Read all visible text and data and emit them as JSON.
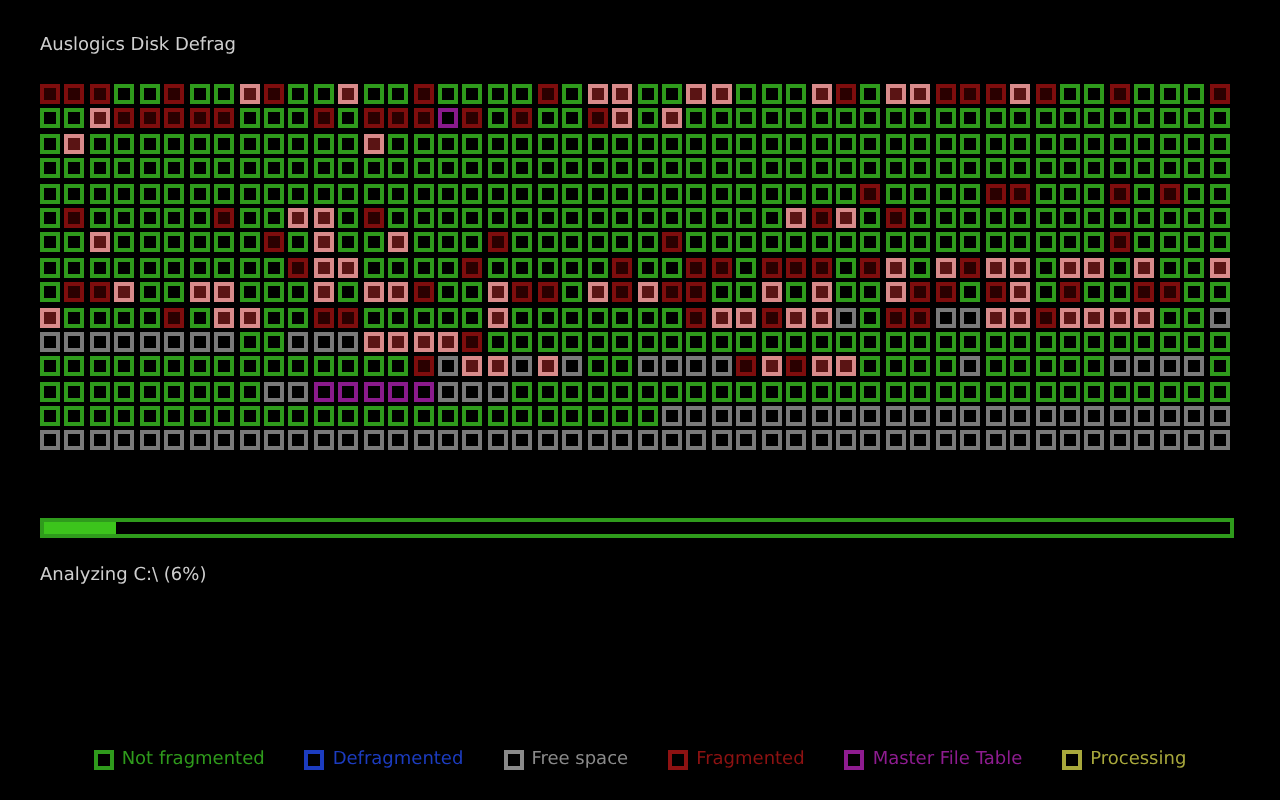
{
  "window": {
    "title": "Auslogics Disk Defrag"
  },
  "disk_map": {
    "rows": [
      [
        {
          "kind": "frag"
        },
        {
          "kind": "frag"
        },
        {
          "kind": "frag"
        },
        {
          "kind": "ok"
        },
        {
          "kind": "ok"
        },
        {
          "kind": "frag"
        },
        {
          "kind": "ok"
        },
        {
          "kind": "ok"
        },
        {
          "kind": "heavy"
        },
        {
          "kind": "frag"
        },
        {
          "kind": "ok"
        },
        {
          "kind": "ok"
        },
        {
          "kind": "heavy"
        },
        {
          "kind": "ok"
        },
        {
          "kind": "ok"
        },
        {
          "kind": "frag"
        },
        {
          "kind": "ok"
        },
        {
          "kind": "ok"
        },
        {
          "kind": "ok"
        },
        {
          "kind": "ok"
        },
        {
          "kind": "frag"
        },
        {
          "kind": "ok"
        },
        {
          "kind": "heavy"
        },
        {
          "kind": "heavy"
        },
        {
          "kind": "ok"
        },
        {
          "kind": "ok"
        },
        {
          "kind": "heavy"
        },
        {
          "kind": "heavy"
        },
        {
          "kind": "ok"
        },
        {
          "kind": "ok"
        },
        {
          "kind": "ok"
        },
        {
          "kind": "heavy"
        },
        {
          "kind": "frag"
        },
        {
          "kind": "ok"
        },
        {
          "kind": "heavy"
        },
        {
          "kind": "heavy"
        },
        {
          "kind": "frag"
        },
        {
          "kind": "frag"
        },
        {
          "kind": "frag"
        },
        {
          "kind": "heavy"
        },
        {
          "kind": "frag"
        },
        {
          "kind": "ok"
        },
        {
          "kind": "ok"
        },
        {
          "kind": "frag"
        },
        {
          "kind": "ok"
        },
        {
          "kind": "ok"
        },
        {
          "kind": "ok"
        },
        {
          "kind": "frag"
        }
      ],
      [
        {
          "kind": "ok"
        },
        {
          "kind": "ok"
        },
        {
          "kind": "heavy"
        },
        {
          "kind": "frag"
        },
        {
          "kind": "frag"
        },
        {
          "kind": "frag"
        },
        {
          "kind": "frag"
        },
        {
          "kind": "frag"
        },
        {
          "kind": "ok"
        },
        {
          "kind": "ok"
        },
        {
          "kind": "ok"
        },
        {
          "kind": "frag"
        },
        {
          "kind": "ok"
        },
        {
          "kind": "frag"
        },
        {
          "kind": "frag"
        },
        {
          "kind": "frag"
        },
        {
          "kind": "mft"
        },
        {
          "kind": "frag"
        },
        {
          "kind": "ok"
        },
        {
          "kind": "frag"
        },
        {
          "kind": "ok"
        },
        {
          "kind": "ok"
        },
        {
          "kind": "frag"
        },
        {
          "kind": "heavy"
        },
        {
          "kind": "ok"
        },
        {
          "kind": "heavy"
        },
        {
          "kind": "ok"
        },
        {
          "kind": "ok"
        },
        {
          "kind": "ok"
        },
        {
          "kind": "ok"
        },
        {
          "kind": "ok"
        },
        {
          "kind": "ok"
        },
        {
          "kind": "ok"
        },
        {
          "kind": "ok"
        },
        {
          "kind": "ok"
        },
        {
          "kind": "ok"
        },
        {
          "kind": "ok"
        },
        {
          "kind": "ok"
        },
        {
          "kind": "ok"
        },
        {
          "kind": "ok"
        },
        {
          "kind": "ok"
        },
        {
          "kind": "ok"
        },
        {
          "kind": "ok"
        },
        {
          "kind": "ok"
        },
        {
          "kind": "ok"
        },
        {
          "kind": "ok"
        },
        {
          "kind": "ok"
        },
        {
          "kind": "ok"
        }
      ],
      [
        {
          "kind": "ok"
        },
        {
          "kind": "heavy"
        },
        {
          "kind": "ok"
        },
        {
          "kind": "ok"
        },
        {
          "kind": "ok"
        },
        {
          "kind": "ok"
        },
        {
          "kind": "ok"
        },
        {
          "kind": "ok"
        },
        {
          "kind": "ok"
        },
        {
          "kind": "ok"
        },
        {
          "kind": "ok"
        },
        {
          "kind": "ok"
        },
        {
          "kind": "ok"
        },
        {
          "kind": "heavy"
        },
        {
          "kind": "ok"
        },
        {
          "kind": "ok"
        },
        {
          "kind": "ok"
        },
        {
          "kind": "ok"
        },
        {
          "kind": "ok"
        },
        {
          "kind": "ok"
        },
        {
          "kind": "ok"
        },
        {
          "kind": "ok"
        },
        {
          "kind": "ok"
        },
        {
          "kind": "ok"
        },
        {
          "kind": "ok"
        },
        {
          "kind": "ok"
        },
        {
          "kind": "ok"
        },
        {
          "kind": "ok"
        },
        {
          "kind": "ok"
        },
        {
          "kind": "ok"
        },
        {
          "kind": "ok"
        },
        {
          "kind": "ok"
        },
        {
          "kind": "ok"
        },
        {
          "kind": "ok"
        },
        {
          "kind": "ok"
        },
        {
          "kind": "ok"
        },
        {
          "kind": "ok"
        },
        {
          "kind": "ok"
        },
        {
          "kind": "ok"
        },
        {
          "kind": "ok"
        },
        {
          "kind": "ok"
        },
        {
          "kind": "ok"
        },
        {
          "kind": "ok"
        },
        {
          "kind": "ok"
        },
        {
          "kind": "ok"
        },
        {
          "kind": "ok"
        },
        {
          "kind": "ok"
        },
        {
          "kind": "ok"
        }
      ],
      [
        {
          "kind": "ok"
        },
        {
          "kind": "ok"
        },
        {
          "kind": "ok"
        },
        {
          "kind": "ok"
        },
        {
          "kind": "ok"
        },
        {
          "kind": "ok"
        },
        {
          "kind": "ok"
        },
        {
          "kind": "ok"
        },
        {
          "kind": "ok"
        },
        {
          "kind": "ok"
        },
        {
          "kind": "ok"
        },
        {
          "kind": "ok"
        },
        {
          "kind": "ok"
        },
        {
          "kind": "ok"
        },
        {
          "kind": "ok"
        },
        {
          "kind": "ok"
        },
        {
          "kind": "ok"
        },
        {
          "kind": "ok"
        },
        {
          "kind": "ok"
        },
        {
          "kind": "ok"
        },
        {
          "kind": "ok"
        },
        {
          "kind": "ok"
        },
        {
          "kind": "ok"
        },
        {
          "kind": "ok"
        },
        {
          "kind": "ok"
        },
        {
          "kind": "ok"
        },
        {
          "kind": "ok"
        },
        {
          "kind": "ok"
        },
        {
          "kind": "ok"
        },
        {
          "kind": "ok"
        },
        {
          "kind": "ok"
        },
        {
          "kind": "ok"
        },
        {
          "kind": "ok"
        },
        {
          "kind": "ok"
        },
        {
          "kind": "ok"
        },
        {
          "kind": "ok"
        },
        {
          "kind": "ok"
        },
        {
          "kind": "ok"
        },
        {
          "kind": "ok"
        },
        {
          "kind": "ok"
        },
        {
          "kind": "ok"
        },
        {
          "kind": "ok"
        },
        {
          "kind": "ok"
        },
        {
          "kind": "ok"
        },
        {
          "kind": "ok"
        },
        {
          "kind": "ok"
        },
        {
          "kind": "ok"
        },
        {
          "kind": "ok"
        }
      ],
      [
        {
          "kind": "ok"
        },
        {
          "kind": "ok"
        },
        {
          "kind": "ok"
        },
        {
          "kind": "ok"
        },
        {
          "kind": "ok"
        },
        {
          "kind": "ok"
        },
        {
          "kind": "ok"
        },
        {
          "kind": "ok"
        },
        {
          "kind": "ok"
        },
        {
          "kind": "ok"
        },
        {
          "kind": "ok"
        },
        {
          "kind": "ok"
        },
        {
          "kind": "ok"
        },
        {
          "kind": "ok"
        },
        {
          "kind": "ok"
        },
        {
          "kind": "ok"
        },
        {
          "kind": "ok"
        },
        {
          "kind": "ok"
        },
        {
          "kind": "ok"
        },
        {
          "kind": "ok"
        },
        {
          "kind": "ok"
        },
        {
          "kind": "ok"
        },
        {
          "kind": "ok"
        },
        {
          "kind": "ok"
        },
        {
          "kind": "ok"
        },
        {
          "kind": "ok"
        },
        {
          "kind": "ok"
        },
        {
          "kind": "ok"
        },
        {
          "kind": "ok"
        },
        {
          "kind": "ok"
        },
        {
          "kind": "ok"
        },
        {
          "kind": "ok"
        },
        {
          "kind": "ok"
        },
        {
          "kind": "frag"
        },
        {
          "kind": "ok"
        },
        {
          "kind": "ok"
        },
        {
          "kind": "ok"
        },
        {
          "kind": "ok"
        },
        {
          "kind": "frag"
        },
        {
          "kind": "frag"
        },
        {
          "kind": "ok"
        },
        {
          "kind": "ok"
        },
        {
          "kind": "ok"
        },
        {
          "kind": "frag"
        },
        {
          "kind": "ok"
        },
        {
          "kind": "frag"
        },
        {
          "kind": "ok"
        },
        {
          "kind": "ok"
        }
      ],
      [
        {
          "kind": "ok"
        },
        {
          "kind": "frag"
        },
        {
          "kind": "ok"
        },
        {
          "kind": "ok"
        },
        {
          "kind": "ok"
        },
        {
          "kind": "ok"
        },
        {
          "kind": "ok"
        },
        {
          "kind": "frag"
        },
        {
          "kind": "ok"
        },
        {
          "kind": "ok"
        },
        {
          "kind": "heavy"
        },
        {
          "kind": "heavy"
        },
        {
          "kind": "ok"
        },
        {
          "kind": "frag"
        },
        {
          "kind": "ok"
        },
        {
          "kind": "ok"
        },
        {
          "kind": "ok"
        },
        {
          "kind": "ok"
        },
        {
          "kind": "ok"
        },
        {
          "kind": "ok"
        },
        {
          "kind": "ok"
        },
        {
          "kind": "ok"
        },
        {
          "kind": "ok"
        },
        {
          "kind": "ok"
        },
        {
          "kind": "ok"
        },
        {
          "kind": "ok"
        },
        {
          "kind": "ok"
        },
        {
          "kind": "ok"
        },
        {
          "kind": "ok"
        },
        {
          "kind": "ok"
        },
        {
          "kind": "heavy"
        },
        {
          "kind": "frag"
        },
        {
          "kind": "heavy"
        },
        {
          "kind": "ok"
        },
        {
          "kind": "frag"
        },
        {
          "kind": "ok"
        },
        {
          "kind": "ok"
        },
        {
          "kind": "ok"
        },
        {
          "kind": "ok"
        },
        {
          "kind": "ok"
        },
        {
          "kind": "ok"
        },
        {
          "kind": "ok"
        },
        {
          "kind": "ok"
        },
        {
          "kind": "ok"
        },
        {
          "kind": "ok"
        },
        {
          "kind": "ok"
        },
        {
          "kind": "ok"
        },
        {
          "kind": "ok"
        }
      ],
      [
        {
          "kind": "ok"
        },
        {
          "kind": "ok"
        },
        {
          "kind": "heavy"
        },
        {
          "kind": "ok"
        },
        {
          "kind": "ok"
        },
        {
          "kind": "ok"
        },
        {
          "kind": "ok"
        },
        {
          "kind": "ok"
        },
        {
          "kind": "ok"
        },
        {
          "kind": "frag"
        },
        {
          "kind": "ok"
        },
        {
          "kind": "heavy"
        },
        {
          "kind": "ok"
        },
        {
          "kind": "ok"
        },
        {
          "kind": "heavy"
        },
        {
          "kind": "ok"
        },
        {
          "kind": "ok"
        },
        {
          "kind": "ok"
        },
        {
          "kind": "frag"
        },
        {
          "kind": "ok"
        },
        {
          "kind": "ok"
        },
        {
          "kind": "ok"
        },
        {
          "kind": "ok"
        },
        {
          "kind": "ok"
        },
        {
          "kind": "ok"
        },
        {
          "kind": "frag"
        },
        {
          "kind": "ok"
        },
        {
          "kind": "ok"
        },
        {
          "kind": "ok"
        },
        {
          "kind": "ok"
        },
        {
          "kind": "ok"
        },
        {
          "kind": "ok"
        },
        {
          "kind": "ok"
        },
        {
          "kind": "ok"
        },
        {
          "kind": "ok"
        },
        {
          "kind": "ok"
        },
        {
          "kind": "ok"
        },
        {
          "kind": "ok"
        },
        {
          "kind": "ok"
        },
        {
          "kind": "ok"
        },
        {
          "kind": "ok"
        },
        {
          "kind": "ok"
        },
        {
          "kind": "ok"
        },
        {
          "kind": "frag"
        },
        {
          "kind": "ok"
        },
        {
          "kind": "ok"
        },
        {
          "kind": "ok"
        },
        {
          "kind": "ok"
        }
      ],
      [
        {
          "kind": "ok"
        },
        {
          "kind": "ok"
        },
        {
          "kind": "ok"
        },
        {
          "kind": "ok"
        },
        {
          "kind": "ok"
        },
        {
          "kind": "ok"
        },
        {
          "kind": "ok"
        },
        {
          "kind": "ok"
        },
        {
          "kind": "ok"
        },
        {
          "kind": "ok"
        },
        {
          "kind": "frag"
        },
        {
          "kind": "heavy"
        },
        {
          "kind": "heavy"
        },
        {
          "kind": "ok"
        },
        {
          "kind": "ok"
        },
        {
          "kind": "ok"
        },
        {
          "kind": "ok"
        },
        {
          "kind": "frag"
        },
        {
          "kind": "ok"
        },
        {
          "kind": "ok"
        },
        {
          "kind": "ok"
        },
        {
          "kind": "ok"
        },
        {
          "kind": "ok"
        },
        {
          "kind": "frag"
        },
        {
          "kind": "ok"
        },
        {
          "kind": "ok"
        },
        {
          "kind": "frag"
        },
        {
          "kind": "frag"
        },
        {
          "kind": "ok"
        },
        {
          "kind": "frag"
        },
        {
          "kind": "frag"
        },
        {
          "kind": "frag"
        },
        {
          "kind": "ok"
        },
        {
          "kind": "frag"
        },
        {
          "kind": "heavy"
        },
        {
          "kind": "ok"
        },
        {
          "kind": "heavy"
        },
        {
          "kind": "frag"
        },
        {
          "kind": "heavy"
        },
        {
          "kind": "heavy"
        },
        {
          "kind": "ok"
        },
        {
          "kind": "heavy"
        },
        {
          "kind": "heavy"
        },
        {
          "kind": "ok"
        },
        {
          "kind": "heavy"
        },
        {
          "kind": "ok"
        },
        {
          "kind": "ok"
        },
        {
          "kind": "heavy"
        }
      ],
      [
        {
          "kind": "ok"
        },
        {
          "kind": "frag"
        },
        {
          "kind": "frag"
        },
        {
          "kind": "heavy"
        },
        {
          "kind": "ok"
        },
        {
          "kind": "ok"
        },
        {
          "kind": "heavy"
        },
        {
          "kind": "heavy"
        },
        {
          "kind": "ok"
        },
        {
          "kind": "ok"
        },
        {
          "kind": "ok"
        },
        {
          "kind": "heavy"
        },
        {
          "kind": "ok"
        },
        {
          "kind": "heavy"
        },
        {
          "kind": "heavy"
        },
        {
          "kind": "frag"
        },
        {
          "kind": "ok"
        },
        {
          "kind": "ok"
        },
        {
          "kind": "heavy"
        },
        {
          "kind": "frag"
        },
        {
          "kind": "frag"
        },
        {
          "kind": "ok"
        },
        {
          "kind": "heavy"
        },
        {
          "kind": "frag"
        },
        {
          "kind": "heavy"
        },
        {
          "kind": "frag"
        },
        {
          "kind": "frag"
        },
        {
          "kind": "ok"
        },
        {
          "kind": "ok"
        },
        {
          "kind": "heavy"
        },
        {
          "kind": "ok"
        },
        {
          "kind": "heavy"
        },
        {
          "kind": "ok"
        },
        {
          "kind": "ok"
        },
        {
          "kind": "heavy"
        },
        {
          "kind": "frag"
        },
        {
          "kind": "frag"
        },
        {
          "kind": "ok"
        },
        {
          "kind": "frag"
        },
        {
          "kind": "heavy"
        },
        {
          "kind": "ok"
        },
        {
          "kind": "frag"
        },
        {
          "kind": "ok"
        },
        {
          "kind": "ok"
        },
        {
          "kind": "frag"
        },
        {
          "kind": "frag"
        },
        {
          "kind": "ok"
        },
        {
          "kind": "ok"
        }
      ],
      [
        {
          "kind": "heavy"
        },
        {
          "kind": "ok"
        },
        {
          "kind": "ok"
        },
        {
          "kind": "ok"
        },
        {
          "kind": "ok"
        },
        {
          "kind": "frag"
        },
        {
          "kind": "ok"
        },
        {
          "kind": "heavy"
        },
        {
          "kind": "heavy"
        },
        {
          "kind": "ok"
        },
        {
          "kind": "ok"
        },
        {
          "kind": "frag"
        },
        {
          "kind": "frag"
        },
        {
          "kind": "ok"
        },
        {
          "kind": "ok"
        },
        {
          "kind": "ok"
        },
        {
          "kind": "ok"
        },
        {
          "kind": "ok"
        },
        {
          "kind": "heavy"
        },
        {
          "kind": "ok"
        },
        {
          "kind": "ok"
        },
        {
          "kind": "ok"
        },
        {
          "kind": "ok"
        },
        {
          "kind": "ok"
        },
        {
          "kind": "ok"
        },
        {
          "kind": "ok"
        },
        {
          "kind": "frag"
        },
        {
          "kind": "heavy"
        },
        {
          "kind": "heavy"
        },
        {
          "kind": "frag"
        },
        {
          "kind": "heavy"
        },
        {
          "kind": "heavy"
        },
        {
          "kind": "free"
        },
        {
          "kind": "ok"
        },
        {
          "kind": "frag"
        },
        {
          "kind": "frag"
        },
        {
          "kind": "free"
        },
        {
          "kind": "free"
        },
        {
          "kind": "heavy"
        },
        {
          "kind": "heavy"
        },
        {
          "kind": "frag"
        },
        {
          "kind": "heavy"
        },
        {
          "kind": "heavy"
        },
        {
          "kind": "heavy"
        },
        {
          "kind": "heavy"
        },
        {
          "kind": "ok"
        },
        {
          "kind": "ok"
        },
        {
          "kind": "free"
        }
      ],
      [
        {
          "kind": "free"
        },
        {
          "kind": "free"
        },
        {
          "kind": "free"
        },
        {
          "kind": "free"
        },
        {
          "kind": "free"
        },
        {
          "kind": "free"
        },
        {
          "kind": "free"
        },
        {
          "kind": "free"
        },
        {
          "kind": "ok"
        },
        {
          "kind": "ok"
        },
        {
          "kind": "free"
        },
        {
          "kind": "free"
        },
        {
          "kind": "free"
        },
        {
          "kind": "heavy"
        },
        {
          "kind": "heavy"
        },
        {
          "kind": "heavy"
        },
        {
          "kind": "heavy"
        },
        {
          "kind": "frag"
        },
        {
          "kind": "ok"
        },
        {
          "kind": "ok"
        },
        {
          "kind": "ok"
        },
        {
          "kind": "ok"
        },
        {
          "kind": "ok"
        },
        {
          "kind": "ok"
        },
        {
          "kind": "ok"
        },
        {
          "kind": "ok"
        },
        {
          "kind": "ok"
        },
        {
          "kind": "ok"
        },
        {
          "kind": "ok"
        },
        {
          "kind": "ok"
        },
        {
          "kind": "ok"
        },
        {
          "kind": "ok"
        },
        {
          "kind": "ok"
        },
        {
          "kind": "ok"
        },
        {
          "kind": "ok"
        },
        {
          "kind": "ok"
        },
        {
          "kind": "ok"
        },
        {
          "kind": "ok"
        },
        {
          "kind": "ok"
        },
        {
          "kind": "ok"
        },
        {
          "kind": "ok"
        },
        {
          "kind": "ok"
        },
        {
          "kind": "ok"
        },
        {
          "kind": "ok"
        },
        {
          "kind": "ok"
        },
        {
          "kind": "ok"
        },
        {
          "kind": "ok"
        },
        {
          "kind": "ok"
        }
      ],
      [
        {
          "kind": "ok"
        },
        {
          "kind": "ok"
        },
        {
          "kind": "ok"
        },
        {
          "kind": "ok"
        },
        {
          "kind": "ok"
        },
        {
          "kind": "ok"
        },
        {
          "kind": "ok"
        },
        {
          "kind": "ok"
        },
        {
          "kind": "ok"
        },
        {
          "kind": "ok"
        },
        {
          "kind": "ok"
        },
        {
          "kind": "ok"
        },
        {
          "kind": "ok"
        },
        {
          "kind": "ok"
        },
        {
          "kind": "ok"
        },
        {
          "kind": "frag"
        },
        {
          "kind": "free"
        },
        {
          "kind": "heavy"
        },
        {
          "kind": "heavy"
        },
        {
          "kind": "free"
        },
        {
          "kind": "heavy"
        },
        {
          "kind": "free"
        },
        {
          "kind": "ok"
        },
        {
          "kind": "ok"
        },
        {
          "kind": "free"
        },
        {
          "kind": "free"
        },
        {
          "kind": "free"
        },
        {
          "kind": "free"
        },
        {
          "kind": "frag"
        },
        {
          "kind": "heavy"
        },
        {
          "kind": "frag"
        },
        {
          "kind": "heavy"
        },
        {
          "kind": "heavy"
        },
        {
          "kind": "ok"
        },
        {
          "kind": "ok"
        },
        {
          "kind": "ok"
        },
        {
          "kind": "ok"
        },
        {
          "kind": "free"
        },
        {
          "kind": "ok"
        },
        {
          "kind": "ok"
        },
        {
          "kind": "ok"
        },
        {
          "kind": "ok"
        },
        {
          "kind": "ok"
        },
        {
          "kind": "free"
        },
        {
          "kind": "free"
        },
        {
          "kind": "free"
        },
        {
          "kind": "free"
        },
        {
          "kind": "ok"
        }
      ],
      [
        {
          "kind": "ok"
        },
        {
          "kind": "ok"
        },
        {
          "kind": "ok"
        },
        {
          "kind": "ok"
        },
        {
          "kind": "ok"
        },
        {
          "kind": "ok"
        },
        {
          "kind": "ok"
        },
        {
          "kind": "ok"
        },
        {
          "kind": "ok"
        },
        {
          "kind": "free"
        },
        {
          "kind": "free"
        },
        {
          "kind": "mft"
        },
        {
          "kind": "mft"
        },
        {
          "kind": "mft"
        },
        {
          "kind": "mft"
        },
        {
          "kind": "mft"
        },
        {
          "kind": "free"
        },
        {
          "kind": "free"
        },
        {
          "kind": "free"
        },
        {
          "kind": "ok"
        },
        {
          "kind": "ok"
        },
        {
          "kind": "ok"
        },
        {
          "kind": "ok"
        },
        {
          "kind": "ok"
        },
        {
          "kind": "ok"
        },
        {
          "kind": "ok"
        },
        {
          "kind": "ok"
        },
        {
          "kind": "ok"
        },
        {
          "kind": "ok"
        },
        {
          "kind": "ok"
        },
        {
          "kind": "ok"
        },
        {
          "kind": "ok"
        },
        {
          "kind": "ok"
        },
        {
          "kind": "ok"
        },
        {
          "kind": "ok"
        },
        {
          "kind": "ok"
        },
        {
          "kind": "ok"
        },
        {
          "kind": "ok"
        },
        {
          "kind": "ok"
        },
        {
          "kind": "ok"
        },
        {
          "kind": "ok"
        },
        {
          "kind": "ok"
        },
        {
          "kind": "ok"
        },
        {
          "kind": "ok"
        },
        {
          "kind": "ok"
        },
        {
          "kind": "ok"
        },
        {
          "kind": "ok"
        },
        {
          "kind": "ok"
        }
      ],
      [
        {
          "kind": "ok"
        },
        {
          "kind": "ok"
        },
        {
          "kind": "ok"
        },
        {
          "kind": "ok"
        },
        {
          "kind": "ok"
        },
        {
          "kind": "ok"
        },
        {
          "kind": "ok"
        },
        {
          "kind": "ok"
        },
        {
          "kind": "ok"
        },
        {
          "kind": "ok"
        },
        {
          "kind": "ok"
        },
        {
          "kind": "ok"
        },
        {
          "kind": "ok"
        },
        {
          "kind": "ok"
        },
        {
          "kind": "ok"
        },
        {
          "kind": "ok"
        },
        {
          "kind": "ok"
        },
        {
          "kind": "ok"
        },
        {
          "kind": "ok"
        },
        {
          "kind": "ok"
        },
        {
          "kind": "ok"
        },
        {
          "kind": "ok"
        },
        {
          "kind": "ok"
        },
        {
          "kind": "ok"
        },
        {
          "kind": "ok"
        },
        {
          "kind": "free"
        },
        {
          "kind": "free"
        },
        {
          "kind": "free"
        },
        {
          "kind": "free"
        },
        {
          "kind": "free"
        },
        {
          "kind": "free"
        },
        {
          "kind": "free"
        },
        {
          "kind": "free"
        },
        {
          "kind": "free"
        },
        {
          "kind": "free"
        },
        {
          "kind": "free"
        },
        {
          "kind": "free"
        },
        {
          "kind": "free"
        },
        {
          "kind": "free"
        },
        {
          "kind": "free"
        },
        {
          "kind": "free"
        },
        {
          "kind": "free"
        },
        {
          "kind": "free"
        },
        {
          "kind": "free"
        },
        {
          "kind": "free"
        },
        {
          "kind": "free"
        },
        {
          "kind": "free"
        },
        {
          "kind": "free"
        }
      ],
      [
        {
          "kind": "free"
        },
        {
          "kind": "free"
        },
        {
          "kind": "free"
        },
        {
          "kind": "free"
        },
        {
          "kind": "free"
        },
        {
          "kind": "free"
        },
        {
          "kind": "free"
        },
        {
          "kind": "free"
        },
        {
          "kind": "free"
        },
        {
          "kind": "free"
        },
        {
          "kind": "free"
        },
        {
          "kind": "free"
        },
        {
          "kind": "free"
        },
        {
          "kind": "free"
        },
        {
          "kind": "free"
        },
        {
          "kind": "free"
        },
        {
          "kind": "free"
        },
        {
          "kind": "free"
        },
        {
          "kind": "free"
        },
        {
          "kind": "free"
        },
        {
          "kind": "free"
        },
        {
          "kind": "free"
        },
        {
          "kind": "free"
        },
        {
          "kind": "free"
        },
        {
          "kind": "free"
        },
        {
          "kind": "free"
        },
        {
          "kind": "free"
        },
        {
          "kind": "free"
        },
        {
          "kind": "free"
        },
        {
          "kind": "free"
        },
        {
          "kind": "free"
        },
        {
          "kind": "free"
        },
        {
          "kind": "free"
        },
        {
          "kind": "free"
        },
        {
          "kind": "free"
        },
        {
          "kind": "free"
        },
        {
          "kind": "free"
        },
        {
          "kind": "free"
        },
        {
          "kind": "free"
        },
        {
          "kind": "free"
        },
        {
          "kind": "free"
        },
        {
          "kind": "free"
        },
        {
          "kind": "free"
        },
        {
          "kind": "free"
        },
        {
          "kind": "free"
        },
        {
          "kind": "free"
        },
        {
          "kind": "free"
        },
        {
          "kind": "free"
        }
      ]
    ]
  },
  "progress": {
    "level": 0.06
  },
  "status": "Analyzing C:\\ (6%)",
  "legend": [
    {
      "label": "Not fragmented",
      "color": "#2f9b1c"
    },
    {
      "label": "Defragmented",
      "color": "#1c3cc0"
    },
    {
      "label": "Free space",
      "color": "#8a8a8a"
    },
    {
      "label": "Fragmented",
      "color": "#8e1212"
    },
    {
      "label": "Master File Table",
      "color": "#8e1c90"
    },
    {
      "label": "Processing",
      "color": "#a8a83c"
    }
  ]
}
